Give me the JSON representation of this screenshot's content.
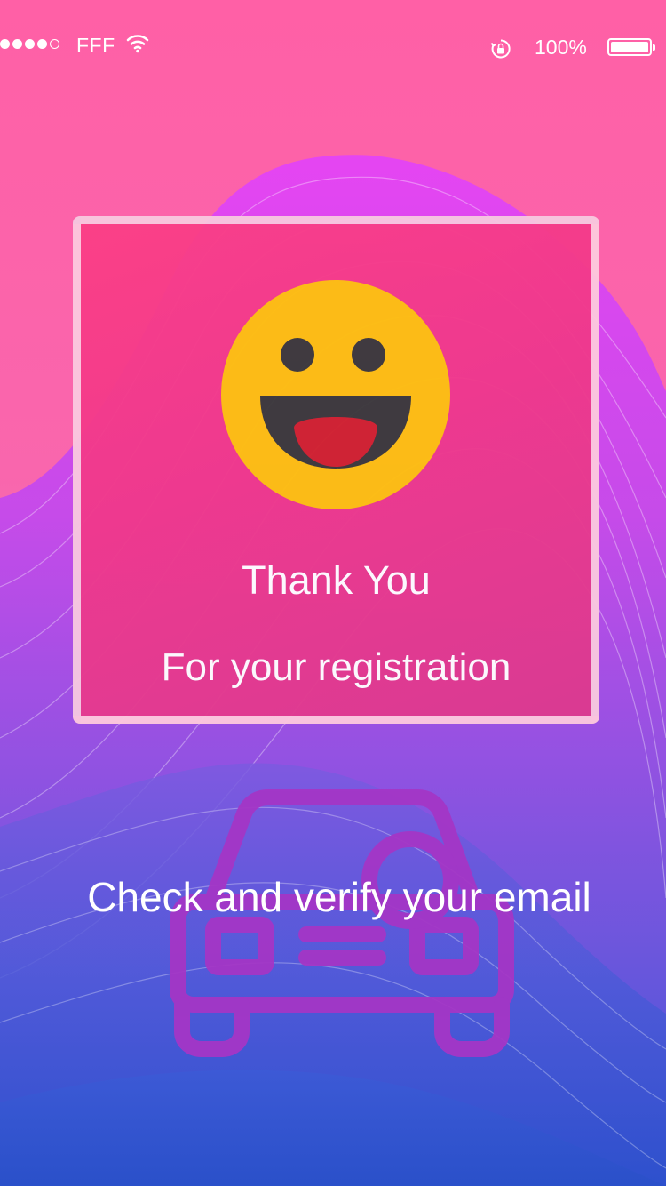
{
  "status_bar": {
    "carrier": "FFF",
    "signal_strength": "4 of 5",
    "battery_percent": "100%",
    "battery_level": 1.0,
    "icons": [
      "signal-dots",
      "wifi-icon",
      "rotation-lock-icon",
      "battery-icon"
    ]
  },
  "card": {
    "icon": "smiley-face-icon",
    "title": "Thank You",
    "subtitle": "For your registration"
  },
  "footer": {
    "background_icon": "car-icon",
    "message": "Check and verify your email"
  },
  "colors": {
    "top_pink": "#ff5fa8",
    "card_pink": "#f0398c",
    "bottom_blue": "#2d4fcc",
    "accent_purple": "#e044f0",
    "smiley_yellow": "#fec00f",
    "smiley_dark": "#3a3a3a",
    "tongue_red": "#d0222e"
  }
}
